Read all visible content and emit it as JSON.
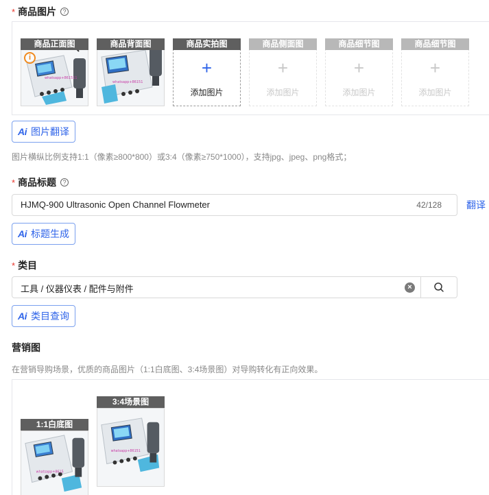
{
  "product_images": {
    "label": "商品图片",
    "required_mark": "*",
    "help_glyph": "?",
    "slots": [
      {
        "tag": "商品正面图",
        "state": "image",
        "warning": true
      },
      {
        "tag": "商品背面图",
        "state": "image",
        "warning": false
      },
      {
        "tag": "商品实拍图",
        "state": "add",
        "add_text": "添加图片"
      },
      {
        "tag": "商品侧面图",
        "state": "disabled",
        "add_text": "添加图片"
      },
      {
        "tag": "商品细节图",
        "state": "disabled",
        "add_text": "添加图片"
      },
      {
        "tag": "商品细节图",
        "state": "disabled",
        "add_text": "添加图片"
      }
    ],
    "plus_glyph": "+",
    "warning_glyph": "i",
    "ai_button": {
      "ai": "Ai",
      "label": "图片翻译"
    },
    "hint": "图片横纵比例支持1:1（像素≥800*800）或3:4（像素≥750*1000），支持jpg、jpeg、png格式；"
  },
  "product_title": {
    "label": "商品标题",
    "required_mark": "*",
    "help_glyph": "?",
    "value": "HJMQ-900 Ultrasonic Open Channel Flowmeter",
    "count": "42/128",
    "translate_link": "翻译",
    "ai_button": {
      "ai": "Ai",
      "label": "标题生成"
    }
  },
  "category": {
    "label": "类目",
    "required_mark": "*",
    "value": "工具 / 仪器仪表 / 配件与附件",
    "clear_glyph": "×",
    "ai_button": {
      "ai": "Ai",
      "label": "类目查询"
    }
  },
  "marketing": {
    "label": "营销图",
    "hint": "在营销导购场景，优质的商品图片（1:1白底图、3:4场景图）对导购转化有正向效果。",
    "slots": [
      {
        "tag": "1:1白底图"
      },
      {
        "tag": "3:4场景图"
      }
    ]
  },
  "colors": {
    "accent": "#2f64e9",
    "required": "#e8362c",
    "tag_bg": "#5f5f5f",
    "warning": "#f08a1e"
  }
}
